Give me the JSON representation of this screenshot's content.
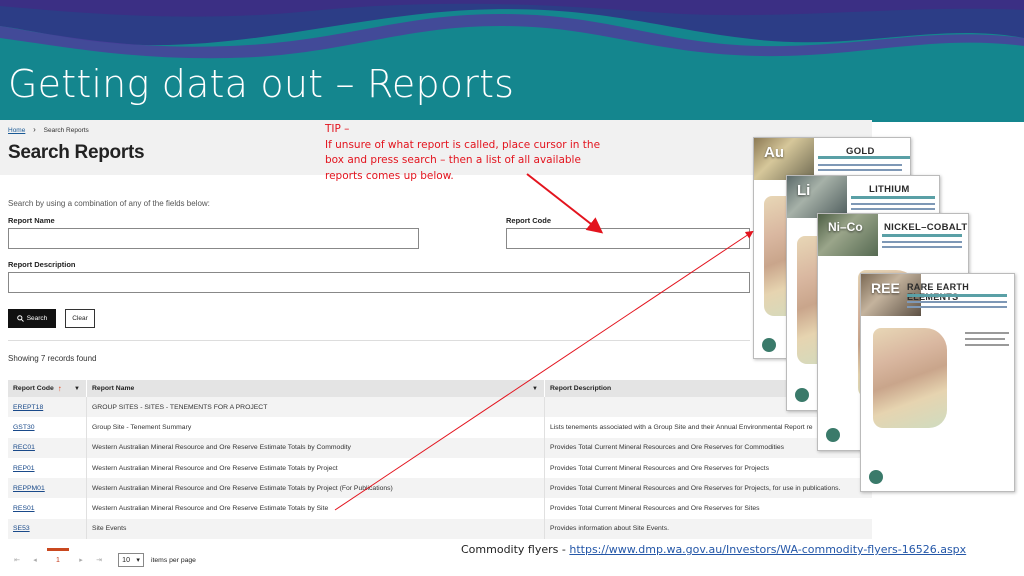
{
  "slide": {
    "title": "Getting data out – Reports",
    "tip": [
      "TIP –",
      "If unsure of what report is called, place cursor in the",
      "box and press search – then a list of all available",
      "reports comes up below."
    ],
    "caption_prefix": "Commodity flyers - ",
    "caption_link": "https://www.dmp.wa.gov.au/Investors/WA-commodity-flyers-16526.aspx",
    "colors": {
      "banner_teal": "#14868e",
      "banner_purple": "#342a7a",
      "tip_red": "#e3141e",
      "search_button": "#111111",
      "sort_arrow": "#e23d12"
    }
  },
  "site": {
    "breadcrumb": {
      "home": "Home",
      "separator_icon": "chevron-right-icon",
      "current": "Search Reports"
    },
    "page_title": "Search Reports",
    "hint": "Search by using a combination of any of the fields below:",
    "fields": {
      "report_name_label": "Report Name",
      "report_code_label": "Report Code",
      "report_description_label": "Report Description",
      "report_name_value": "",
      "report_code_value": "",
      "report_description_value": ""
    },
    "buttons": {
      "search": "Search",
      "search_icon": "search-icon",
      "clear": "Clear"
    },
    "records_text": "Showing 7 records found",
    "table": {
      "headers": {
        "code": "Report Code",
        "name": "Report Name",
        "description": "Report Description"
      },
      "sort_icon": "sort-ascending-icon",
      "filter_icon": "filter-icon",
      "rows": [
        {
          "code": "EREPT18",
          "name": "GROUP SITES - SITES - TENEMENTS FOR A PROJECT",
          "description": ""
        },
        {
          "code": "GST30",
          "name": "Group Site - Tenement Summary",
          "description": "Lists tenements associated with a Group Site and their Annual Environmental Report re"
        },
        {
          "code": "REC01",
          "name": "Western Australian Mineral Resource and Ore Reserve Estimate Totals by Commodity",
          "description": "Provides Total Current Mineral Resources and Ore Reserves for Commodities"
        },
        {
          "code": "REP01",
          "name": "Western Australian Mineral Resource and Ore Reserve Estimate Totals by Project",
          "description": "Provides Total Current Mineral Resources and Ore Reserves for Projects"
        },
        {
          "code": "REPPM01",
          "name": "Western Australian Mineral Resource and Ore Reserve Estimate Totals by Project (For Publications)",
          "description": "Provides Total Current Mineral Resources and Ore Reserves for Projects, for use in publications."
        },
        {
          "code": "RES01",
          "name": "Western Australian Mineral Resource and Ore Reserve Estimate Totals by Site",
          "description": "Provides Total Current Mineral Resources and Ore Reserves for Sites"
        },
        {
          "code": "SE53",
          "name": "Site Events",
          "description": "Provides information about Site Events."
        }
      ]
    },
    "pager": {
      "first": "⇤",
      "prev": "◂",
      "current_page": "1",
      "next": "▸",
      "last": "⇥",
      "page_size": "10",
      "page_size_caret": "▾",
      "items_per_page": "items per page"
    }
  },
  "flyers": [
    {
      "badge": "Au",
      "title": "GOLD"
    },
    {
      "badge": "Li",
      "title": "LITHIUM"
    },
    {
      "badge": "Ni–Co",
      "title": "NICKEL–COBALT"
    },
    {
      "badge": "REE",
      "title": "RARE EARTH ELEMENTS"
    }
  ]
}
